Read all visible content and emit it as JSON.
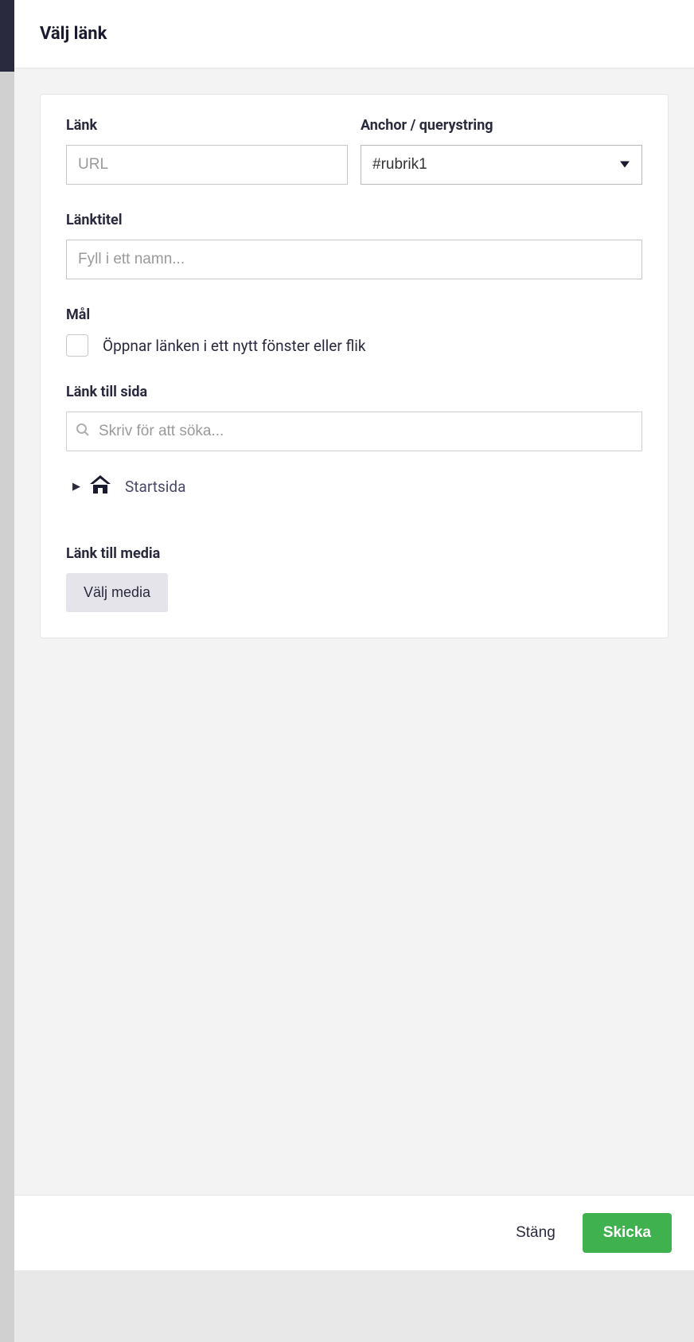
{
  "modal": {
    "title": "Välj länk"
  },
  "form": {
    "link_label": "Länk",
    "link_placeholder": "URL",
    "anchor_label": "Anchor / querystring",
    "anchor_value": "#rubrik1",
    "title_label": "Länktitel",
    "title_placeholder": "Fyll i ett namn...",
    "target_label": "Mål",
    "target_checkbox_label": "Öppnar länken i ett nytt fönster eller flik",
    "page_link_label": "Länk till sida",
    "page_search_placeholder": "Skriv för att söka...",
    "tree_root_label": "Startsida",
    "media_link_label": "Länk till media",
    "choose_media_label": "Välj media"
  },
  "footer": {
    "close_label": "Stäng",
    "submit_label": "Skicka"
  }
}
